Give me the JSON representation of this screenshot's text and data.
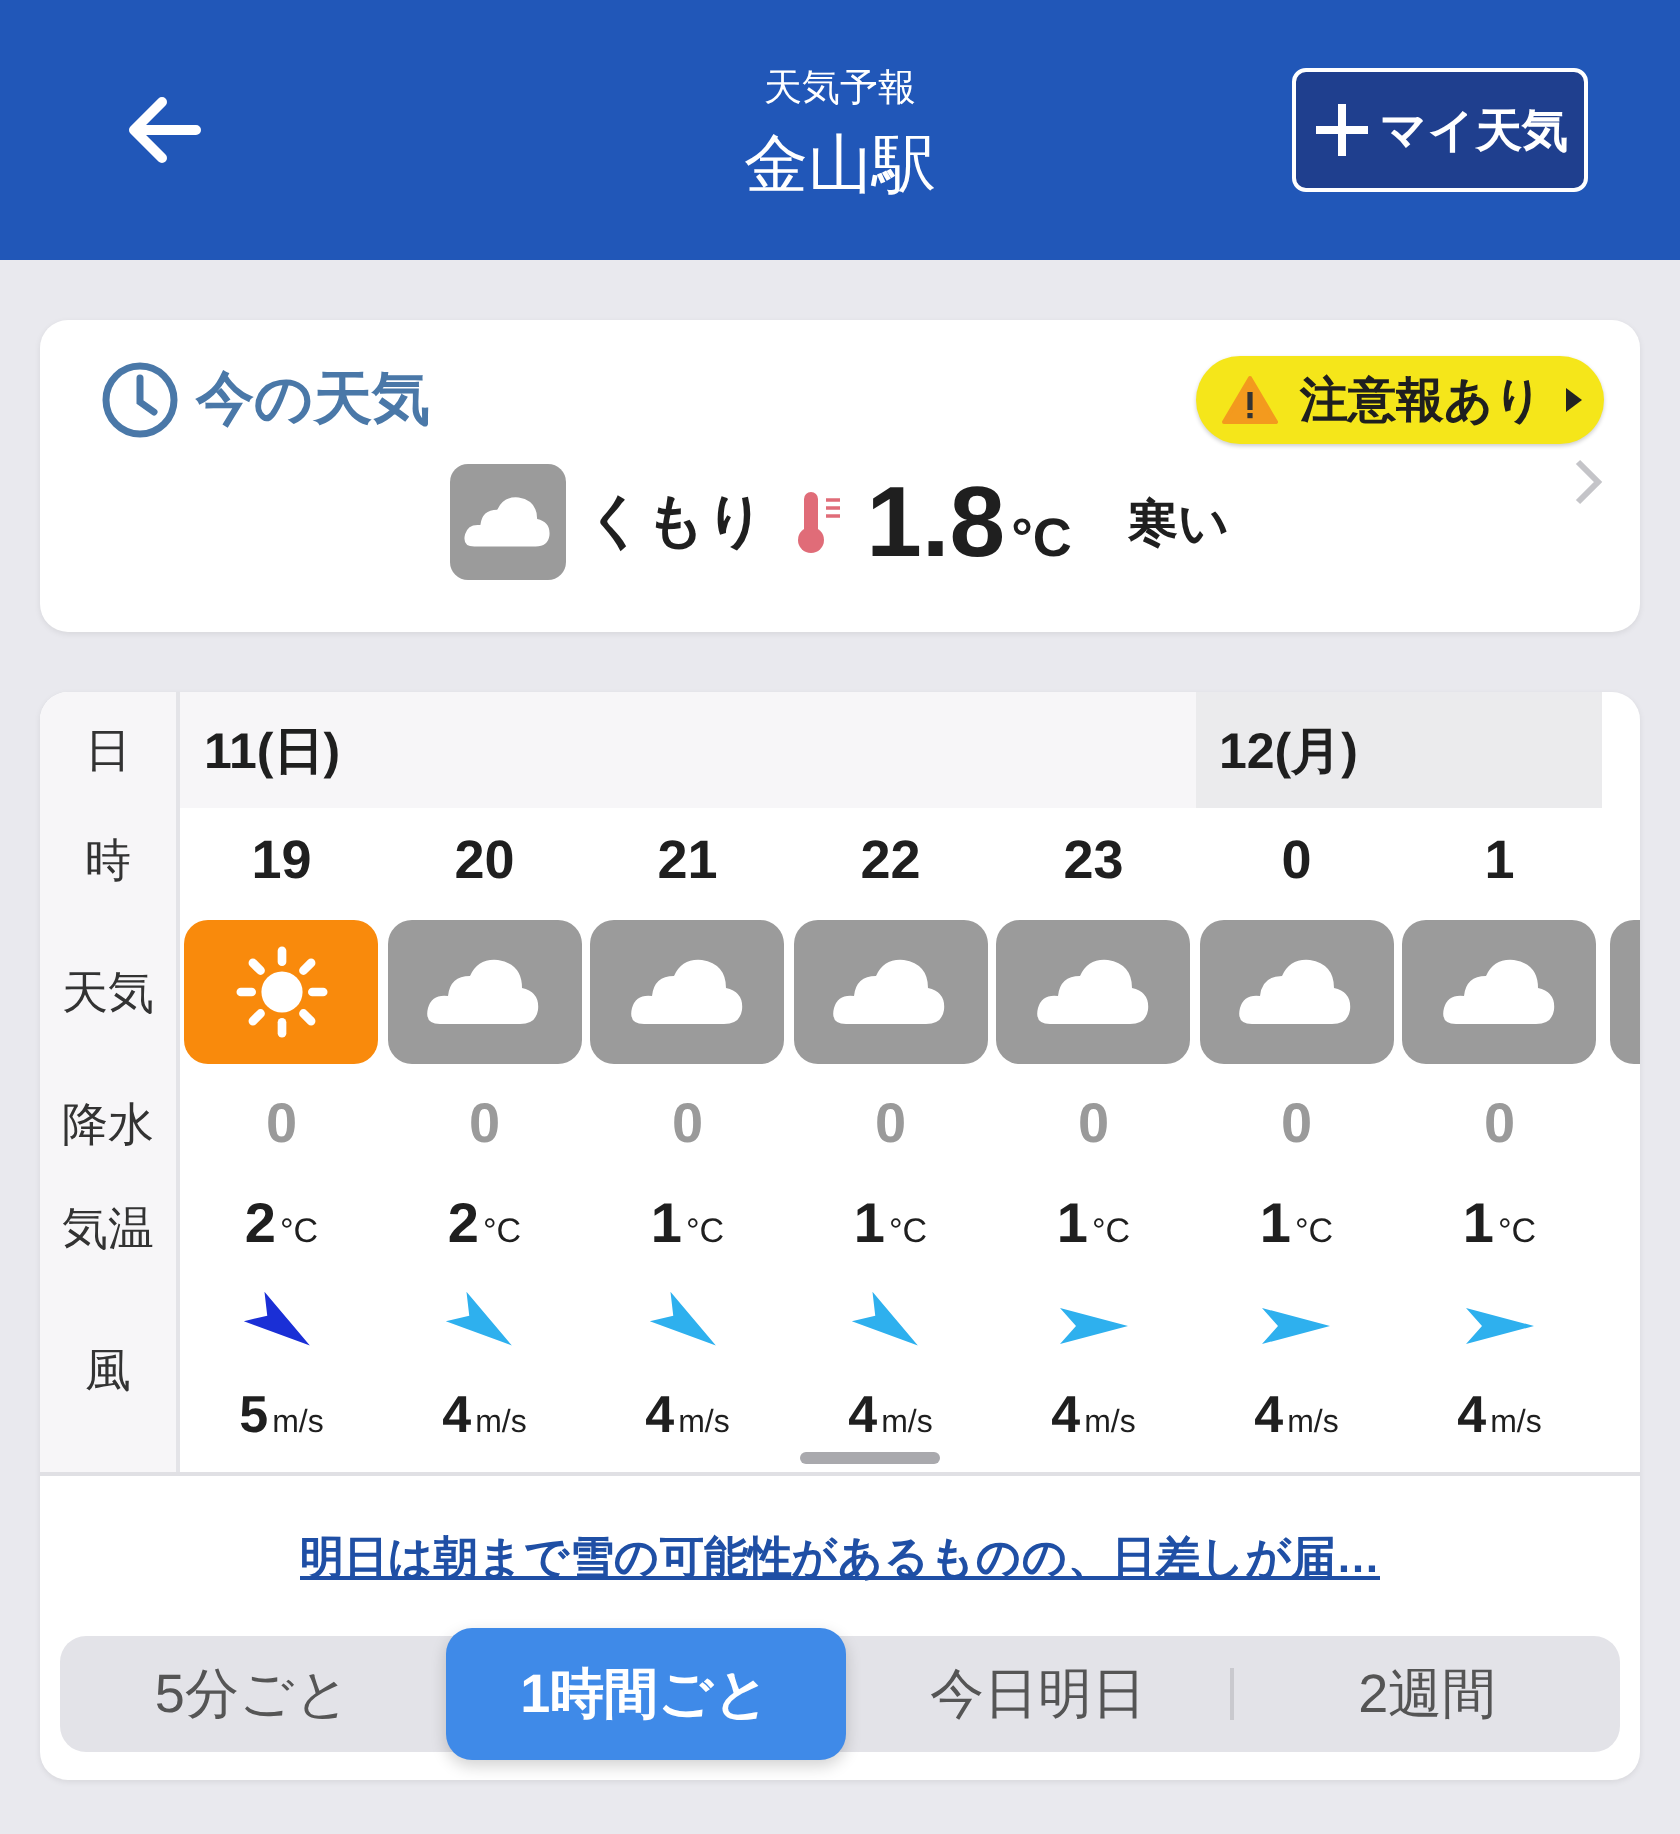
{
  "header": {
    "subtitle": "天気予報",
    "title": "金山駅",
    "my_weather_button": "マイ天気"
  },
  "now": {
    "heading": "今の天気",
    "alert": "注意報あり",
    "icon": {
      "kind": "cloudy"
    },
    "condition": "くもり",
    "temperature": "1.8",
    "unit": "°C",
    "feel": "寒い"
  },
  "forecast": {
    "row_labels": {
      "day": "日",
      "hour": "時",
      "weather": "天気",
      "precip": "降水",
      "temp": "気温",
      "wind": "風"
    },
    "days": [
      {
        "label": "11(日)",
        "shaded": false,
        "hours": [
          {
            "hour": "19",
            "icon": {
              "kind": "sunny"
            },
            "precip": "0",
            "temp": "2",
            "temp_unit": "°C",
            "wind_arrow": {
              "kind": "diagonal",
              "strong": true
            },
            "wind_speed": "5",
            "wind_unit": "m/s"
          },
          {
            "hour": "20",
            "icon": {
              "kind": "cloudy"
            },
            "precip": "0",
            "temp": "2",
            "temp_unit": "°C",
            "wind_arrow": {
              "kind": "diagonal",
              "strong": false
            },
            "wind_speed": "4",
            "wind_unit": "m/s"
          },
          {
            "hour": "21",
            "icon": {
              "kind": "cloudy"
            },
            "precip": "0",
            "temp": "1",
            "temp_unit": "°C",
            "wind_arrow": {
              "kind": "diagonal",
              "strong": false
            },
            "wind_speed": "4",
            "wind_unit": "m/s"
          },
          {
            "hour": "22",
            "icon": {
              "kind": "cloudy"
            },
            "precip": "0",
            "temp": "1",
            "temp_unit": "°C",
            "wind_arrow": {
              "kind": "diagonal",
              "strong": false
            },
            "wind_speed": "4",
            "wind_unit": "m/s"
          },
          {
            "hour": "23",
            "icon": {
              "kind": "cloudy"
            },
            "precip": "0",
            "temp": "1",
            "temp_unit": "°C",
            "wind_arrow": {
              "kind": "horizontal",
              "strong": false
            },
            "wind_speed": "4",
            "wind_unit": "m/s"
          }
        ]
      },
      {
        "label": "12(月)",
        "shaded": true,
        "hours": [
          {
            "hour": "0",
            "icon": {
              "kind": "cloudy"
            },
            "precip": "0",
            "temp": "1",
            "temp_unit": "°C",
            "wind_arrow": {
              "kind": "horizontal",
              "strong": false
            },
            "wind_speed": "4",
            "wind_unit": "m/s"
          },
          {
            "hour": "1",
            "icon": {
              "kind": "cloudy"
            },
            "precip": "0",
            "temp": "1",
            "temp_unit": "°C",
            "wind_arrow": {
              "kind": "horizontal",
              "strong": false
            },
            "wind_speed": "4",
            "wind_unit": "m/s"
          }
        ]
      }
    ],
    "partial_next": {
      "icon": {
        "kind": "cloudy"
      }
    }
  },
  "summary_link": "明日は朝まで雪の可能性があるものの、日差しが届…",
  "tabs": [
    {
      "label": "5分ごと",
      "selected": false
    },
    {
      "label": "1時間ごと",
      "selected": true
    },
    {
      "label": "今日明日",
      "selected": false
    },
    {
      "label": "2週間",
      "selected": false
    }
  ]
}
